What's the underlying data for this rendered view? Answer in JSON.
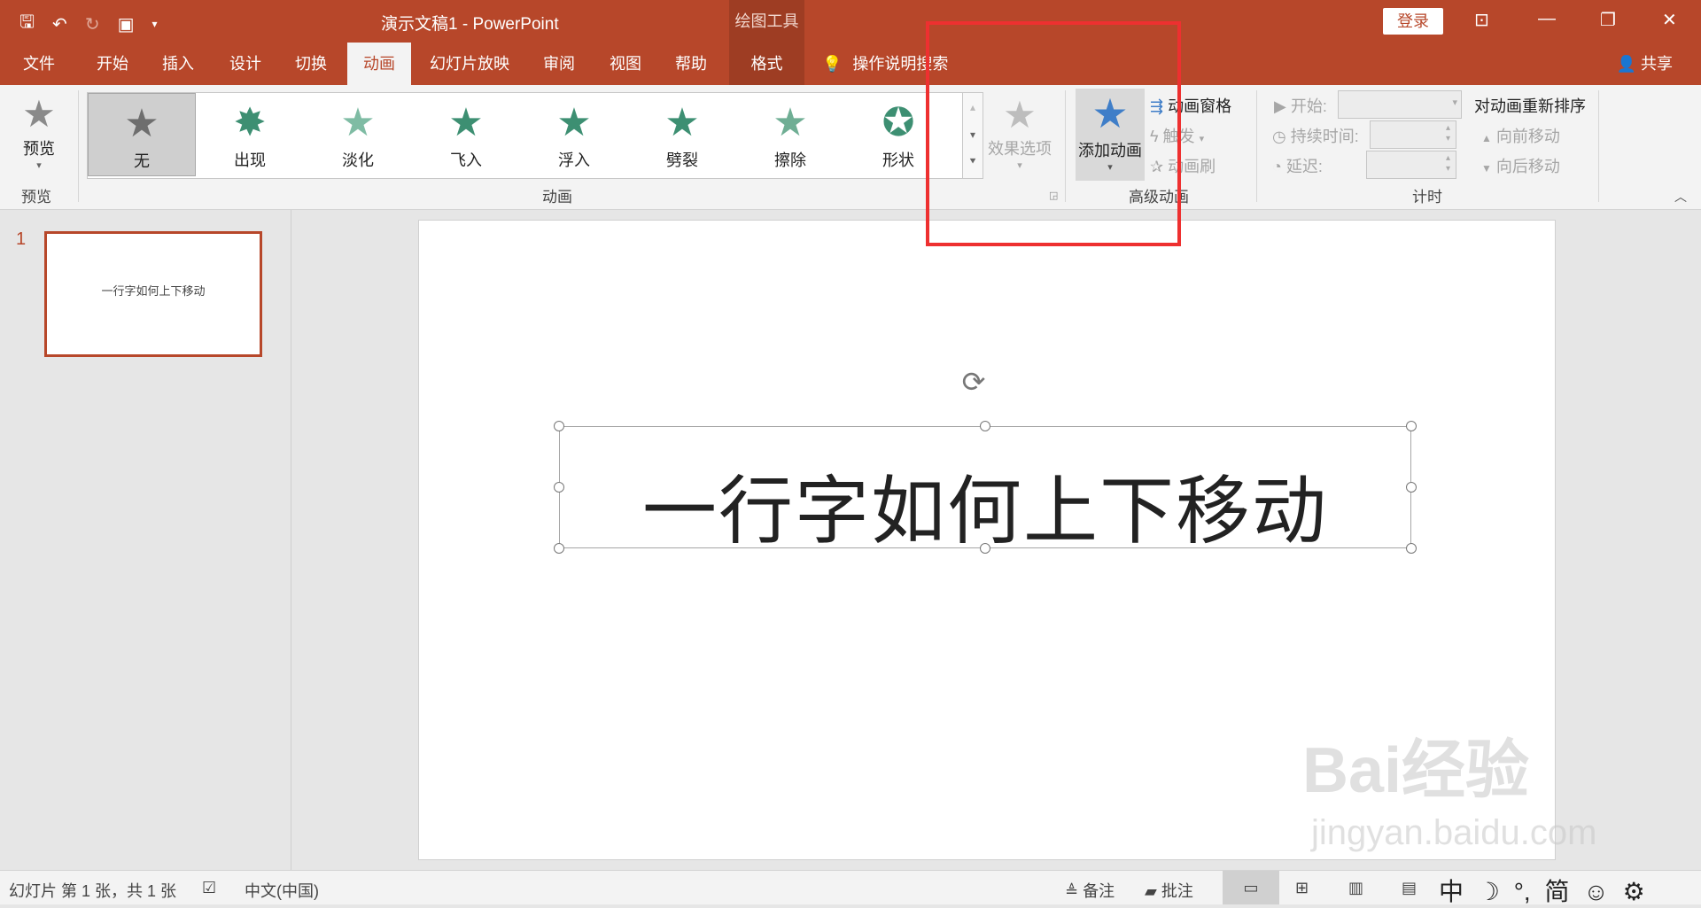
{
  "titlebar": {
    "title": "演示文稿1  -  PowerPoint",
    "context_group": "绘图工具",
    "login": "登录"
  },
  "tabs": {
    "file": "文件",
    "home": "开始",
    "insert": "插入",
    "design": "设计",
    "transitions": "切换",
    "animations": "动画",
    "slideshow": "幻灯片放映",
    "review": "审阅",
    "view": "视图",
    "help": "帮助",
    "format": "格式",
    "tell_me": "操作说明搜索",
    "share": "共享"
  },
  "ribbon": {
    "preview_button": "预览",
    "preview_group": "预览",
    "animation_group": "动画",
    "animations": [
      {
        "label": "无"
      },
      {
        "label": "出现"
      },
      {
        "label": "淡化"
      },
      {
        "label": "飞入"
      },
      {
        "label": "浮入"
      },
      {
        "label": "劈裂"
      },
      {
        "label": "擦除"
      },
      {
        "label": "形状"
      }
    ],
    "effect_options": "效果选项",
    "add_animation": "添加动画",
    "animation_pane": "动画窗格",
    "trigger": "触发",
    "animation_painter": "动画刷",
    "advanced_group": "高级动画",
    "start_label": "开始:",
    "duration_label": "持续时间:",
    "delay_label": "延迟:",
    "reorder_title": "对动画重新排序",
    "move_earlier": "向前移动",
    "move_later": "向后移动",
    "timing_group": "计时"
  },
  "slides": {
    "number": "1",
    "thumb_text": "一行字如何上下移动"
  },
  "slide": {
    "text": "一行字如何上下移动"
  },
  "statusbar": {
    "slide_info": "幻灯片 第 1 张，共 1 张",
    "language": "中文(中国)",
    "notes": "备注",
    "comments": "批注",
    "ime": [
      "中",
      "☽",
      "°,",
      "简",
      "☺",
      "⚙"
    ]
  },
  "watermark": {
    "brand": "Bai经验",
    "url": "jingyan.baidu.com"
  },
  "colors": {
    "accent": "#b7472a",
    "highlight_box": "#ee3030",
    "animation_icon": "#3d8f72"
  }
}
